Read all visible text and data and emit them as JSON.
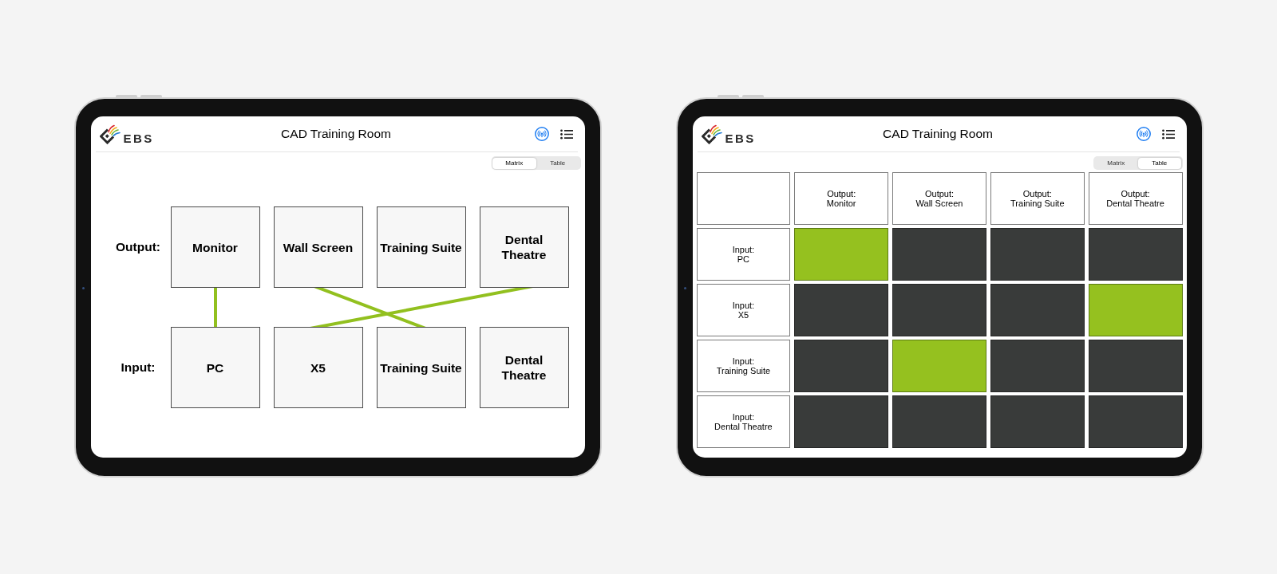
{
  "screens": [
    {
      "kind": "matrix",
      "header": {
        "logo": "EBS",
        "title": "CAD Training Room"
      },
      "view_switch": [
        {
          "label": "Matrix",
          "selected": true
        },
        {
          "label": "Table",
          "selected": false
        }
      ],
      "matrix": {
        "outputs_label": "Output:",
        "inputs_label": "Input:",
        "outputs": [
          "Monitor",
          "Wall Screen",
          "Training Suite",
          "Dental Theatre"
        ],
        "inputs": [
          {
            "label": "PC",
            "routes": [
              {
                "on": true
              },
              {
                "on": false
              },
              {
                "on": false
              },
              {
                "on": false
              }
            ]
          },
          {
            "label": "X5",
            "routes": [
              {
                "on": false
              },
              {
                "on": false
              },
              {
                "on": false
              },
              {
                "on": true
              }
            ]
          },
          {
            "label": "Training Suite",
            "routes": [
              {
                "on": false
              },
              {
                "on": true
              },
              {
                "on": false
              },
              {
                "on": false
              }
            ]
          },
          {
            "label": "Dental Theatre",
            "routes": [
              {
                "on": false
              },
              {
                "on": false
              },
              {
                "on": false
              },
              {
                "on": false
              }
            ]
          }
        ]
      }
    },
    {
      "kind": "table",
      "header": {
        "logo": "EBS",
        "title": "CAD Training Room"
      },
      "view_switch": [
        {
          "label": "Matrix",
          "selected": false
        },
        {
          "label": "Table",
          "selected": true
        }
      ],
      "table": {
        "columns": [
          "Output:\nMonitor",
          "Output:\nWall Screen",
          "Output:\nTraining Suite",
          "Output:\nDental Theatre"
        ],
        "rows": [
          {
            "label": "Input:\nPC",
            "cells": [
              {
                "selected": true
              },
              {
                "selected": false
              },
              {
                "selected": false
              },
              {
                "selected": false
              }
            ]
          },
          {
            "label": "Input:\nX5",
            "cells": [
              {
                "selected": false
              },
              {
                "selected": false
              },
              {
                "selected": false
              },
              {
                "selected": true
              }
            ]
          },
          {
            "label": "Input:\nTraining Suite",
            "cells": [
              {
                "selected": false
              },
              {
                "selected": true
              },
              {
                "selected": false
              },
              {
                "selected": false
              }
            ]
          },
          {
            "label": "Input:\nDental Theatre",
            "cells": [
              {
                "selected": false
              },
              {
                "selected": false
              },
              {
                "selected": false
              },
              {
                "selected": false
              }
            ]
          }
        ]
      }
    }
  ]
}
